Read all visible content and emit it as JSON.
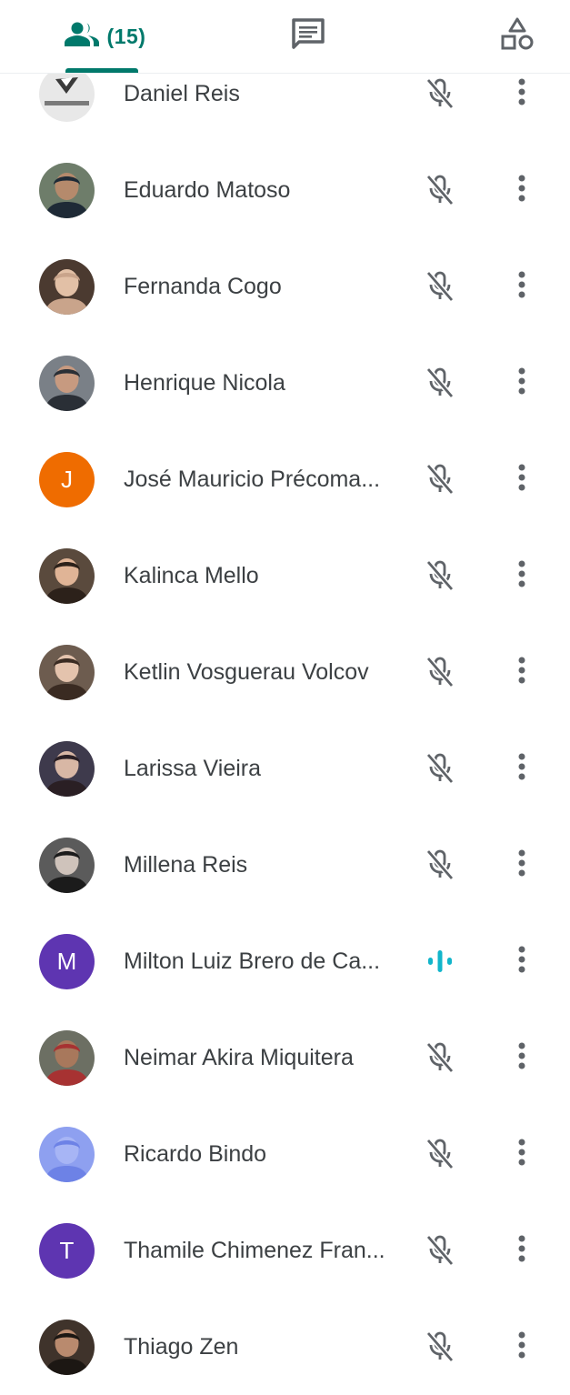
{
  "tabs": {
    "people_count": "(15)"
  },
  "colors": {
    "accent": "#00796b",
    "speaking": "#12b5cb",
    "icon_gray": "#5f6368",
    "avatar_orange": "#ef6c00",
    "avatar_purple": "#5e35b1"
  },
  "participants": [
    {
      "name": "Daniel Reis",
      "avatar_type": "photo",
      "mic": "muted"
    },
    {
      "name": "Eduardo Matoso",
      "avatar_type": "photo",
      "mic": "muted"
    },
    {
      "name": "Fernanda Cogo",
      "avatar_type": "photo",
      "mic": "muted"
    },
    {
      "name": "Henrique Nicola",
      "avatar_type": "photo",
      "mic": "muted"
    },
    {
      "name": "José Mauricio Précoma...",
      "avatar_type": "letter",
      "letter": "J",
      "avatar_color": "#ef6c00",
      "mic": "muted"
    },
    {
      "name": "Kalinca Mello",
      "avatar_type": "photo",
      "mic": "muted"
    },
    {
      "name": "Ketlin Vosguerau Volcov",
      "avatar_type": "photo",
      "mic": "muted"
    },
    {
      "name": "Larissa Vieira",
      "avatar_type": "photo",
      "mic": "muted"
    },
    {
      "name": "Millena Reis",
      "avatar_type": "photo",
      "mic": "muted"
    },
    {
      "name": "Milton Luiz Brero de Ca...",
      "avatar_type": "letter",
      "letter": "M",
      "avatar_color": "#5e35b1",
      "mic": "speaking"
    },
    {
      "name": "Neimar Akira Miquitera",
      "avatar_type": "photo",
      "mic": "muted"
    },
    {
      "name": "Ricardo Bindo",
      "avatar_type": "photo",
      "mic": "muted"
    },
    {
      "name": "Thamile Chimenez Fran...",
      "avatar_type": "letter",
      "letter": "T",
      "avatar_color": "#5e35b1",
      "mic": "muted"
    },
    {
      "name": "Thiago Zen",
      "avatar_type": "photo",
      "mic": "muted"
    }
  ]
}
